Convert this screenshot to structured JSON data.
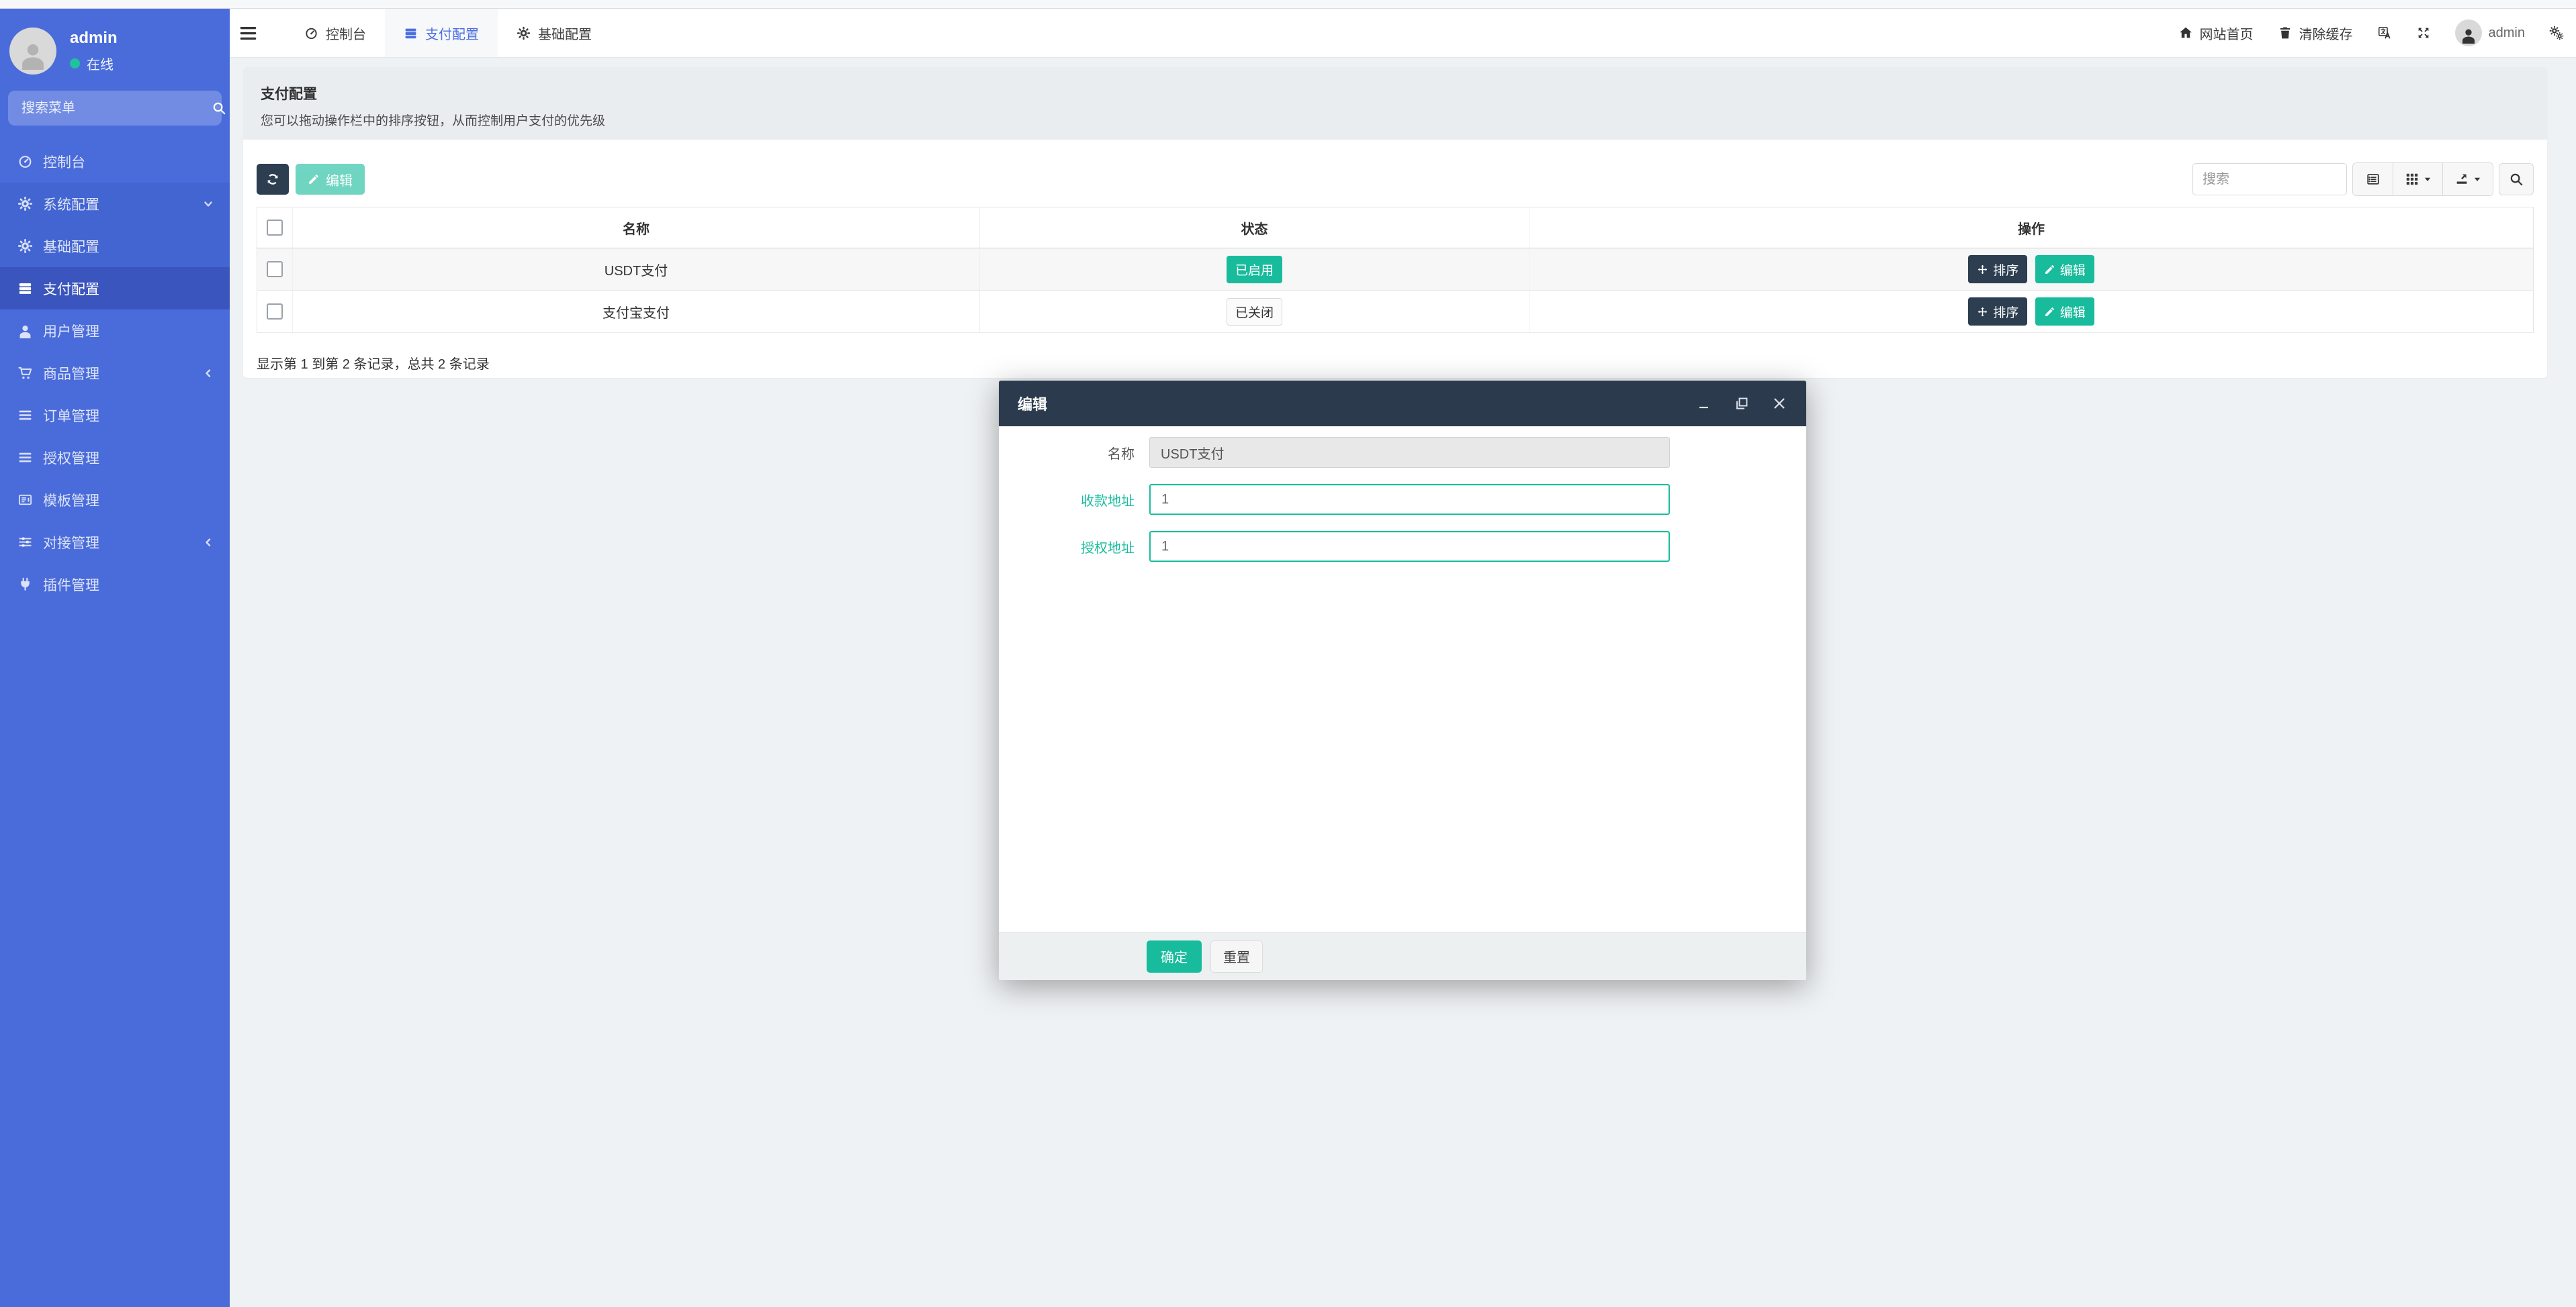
{
  "sidebar": {
    "user": {
      "name": "admin",
      "status": "在线"
    },
    "search_placeholder": "搜索菜单",
    "menu": [
      {
        "label": "控制台"
      },
      {
        "label": "系统配置"
      },
      {
        "label": "基础配置"
      },
      {
        "label": "支付配置"
      },
      {
        "label": "用户管理"
      },
      {
        "label": "商品管理"
      },
      {
        "label": "订单管理"
      },
      {
        "label": "授权管理"
      },
      {
        "label": "模板管理"
      },
      {
        "label": "对接管理"
      },
      {
        "label": "插件管理"
      }
    ]
  },
  "topbar": {
    "tabs": [
      {
        "label": "控制台"
      },
      {
        "label": "支付配置"
      },
      {
        "label": "基础配置"
      }
    ],
    "home_label": "网站首页",
    "clear_cache_label": "清除缓存",
    "username": "admin"
  },
  "page": {
    "title": "支付配置",
    "description": "您可以拖动操作栏中的排序按钮，从而控制用户支付的优先级",
    "toolbar": {
      "edit_label": "编辑",
      "search_placeholder": "搜索"
    },
    "table": {
      "headers": {
        "name": "名称",
        "status": "状态",
        "action": "操作"
      },
      "rows": [
        {
          "name": "USDT支付",
          "status": "已启用",
          "sort_label": "排序",
          "edit_label": "编辑"
        },
        {
          "name": "支付宝支付",
          "status": "已关闭",
          "sort_label": "排序",
          "edit_label": "编辑"
        }
      ],
      "summary": "显示第 1 到第 2 条记录，总共 2 条记录"
    }
  },
  "modal": {
    "title": "编辑",
    "fields": [
      {
        "label": "名称",
        "value": "USDT支付"
      },
      {
        "label": "收款地址",
        "value": "1"
      },
      {
        "label": "授权地址",
        "value": "1"
      }
    ],
    "ok_label": "确定",
    "reset_label": "重置"
  },
  "colors": {
    "sidebar_blue": "#4a6cda",
    "accent_green": "#18bc9c",
    "dark_navy": "#2c3e50",
    "modal_header": "#2c3a4e"
  }
}
